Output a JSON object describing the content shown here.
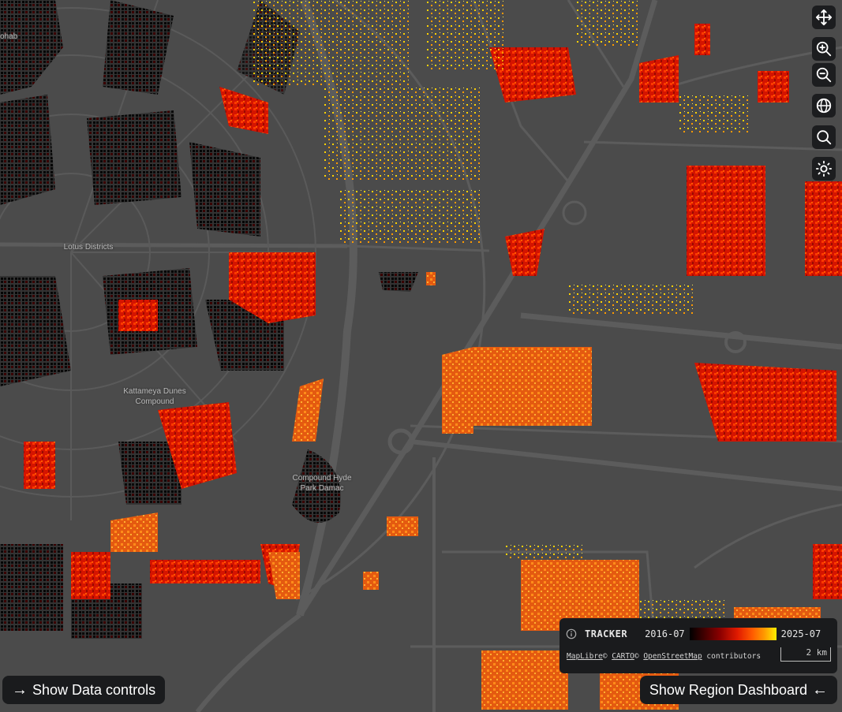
{
  "map": {
    "place_labels": [
      {
        "id": "lotus",
        "text": "Lotus Districts"
      },
      {
        "id": "kattameya",
        "text": "Kattameya Dunes\nCompound"
      },
      {
        "id": "hyde",
        "text": "Compound Hyde\nPark Damac"
      },
      {
        "id": "edge",
        "text": "ohab"
      }
    ],
    "controls": [
      {
        "id": "move",
        "icon": "move-arrows-icon"
      },
      {
        "id": "zoom-in",
        "icon": "zoom-in-icon"
      },
      {
        "id": "zoom-out",
        "icon": "zoom-out-icon"
      },
      {
        "id": "globe",
        "icon": "globe-icon"
      },
      {
        "id": "search",
        "icon": "search-icon"
      },
      {
        "id": "theme",
        "icon": "sun-icon"
      }
    ],
    "colors": {
      "background": "#4b4b4b",
      "roads": "#5d5d5d",
      "building_old": "#000000",
      "building_mid": "#d41400",
      "building_new": "#ffe600"
    }
  },
  "legend": {
    "title": "TRACKER",
    "start": "2016-07",
    "end": "2025-07",
    "attribution": {
      "maplibre": "MapLibre",
      "carto": "CARTO",
      "osm": "OpenStreetMap",
      "tail": "contributors",
      "sep1": "©",
      "sep2": "©"
    },
    "scale_label": "2 km"
  },
  "buttons": {
    "data_controls": "Show Data controls",
    "region_dashboard": "Show Region Dashboard",
    "arrow_right": "→",
    "arrow_left": "←"
  }
}
